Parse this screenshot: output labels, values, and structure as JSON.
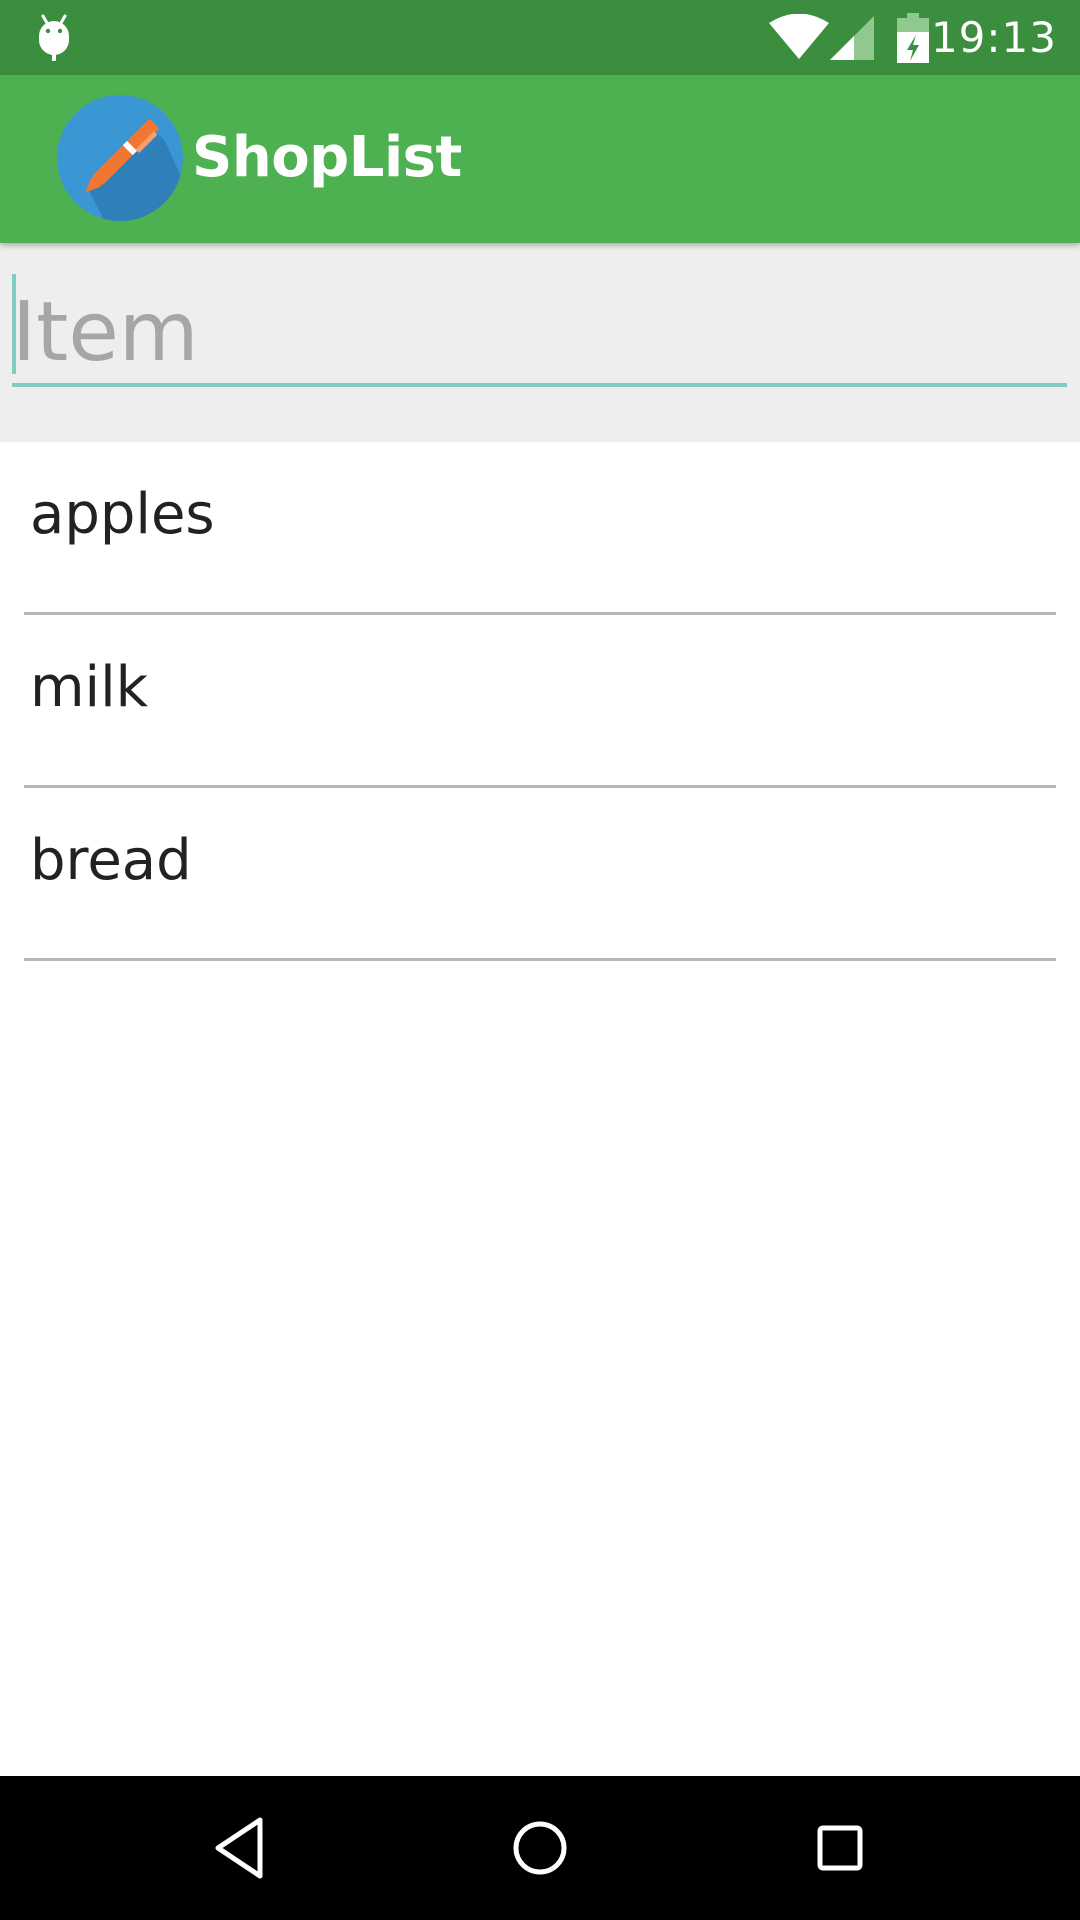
{
  "status_bar": {
    "time": "19:13",
    "icons": [
      "android-icon",
      "wifi-icon",
      "signal-icon",
      "battery-charging-icon"
    ]
  },
  "app_bar": {
    "title": "ShopList",
    "logo_icon": "pen-logo-icon"
  },
  "input": {
    "placeholder": "Item",
    "value": ""
  },
  "list": {
    "items": [
      {
        "label": "apples"
      },
      {
        "label": "milk"
      },
      {
        "label": "bread"
      }
    ]
  },
  "nav_bar": {
    "icons": [
      "back-triangle-icon",
      "home-circle-icon",
      "recents-square-icon"
    ]
  },
  "colors": {
    "status_bar": "#3b8e3d",
    "app_bar": "#4db151",
    "input_area": "#eeeeee",
    "input_underline": "#80cbc4",
    "logo_circle": "#3a97d4",
    "pen": "#f07631"
  }
}
